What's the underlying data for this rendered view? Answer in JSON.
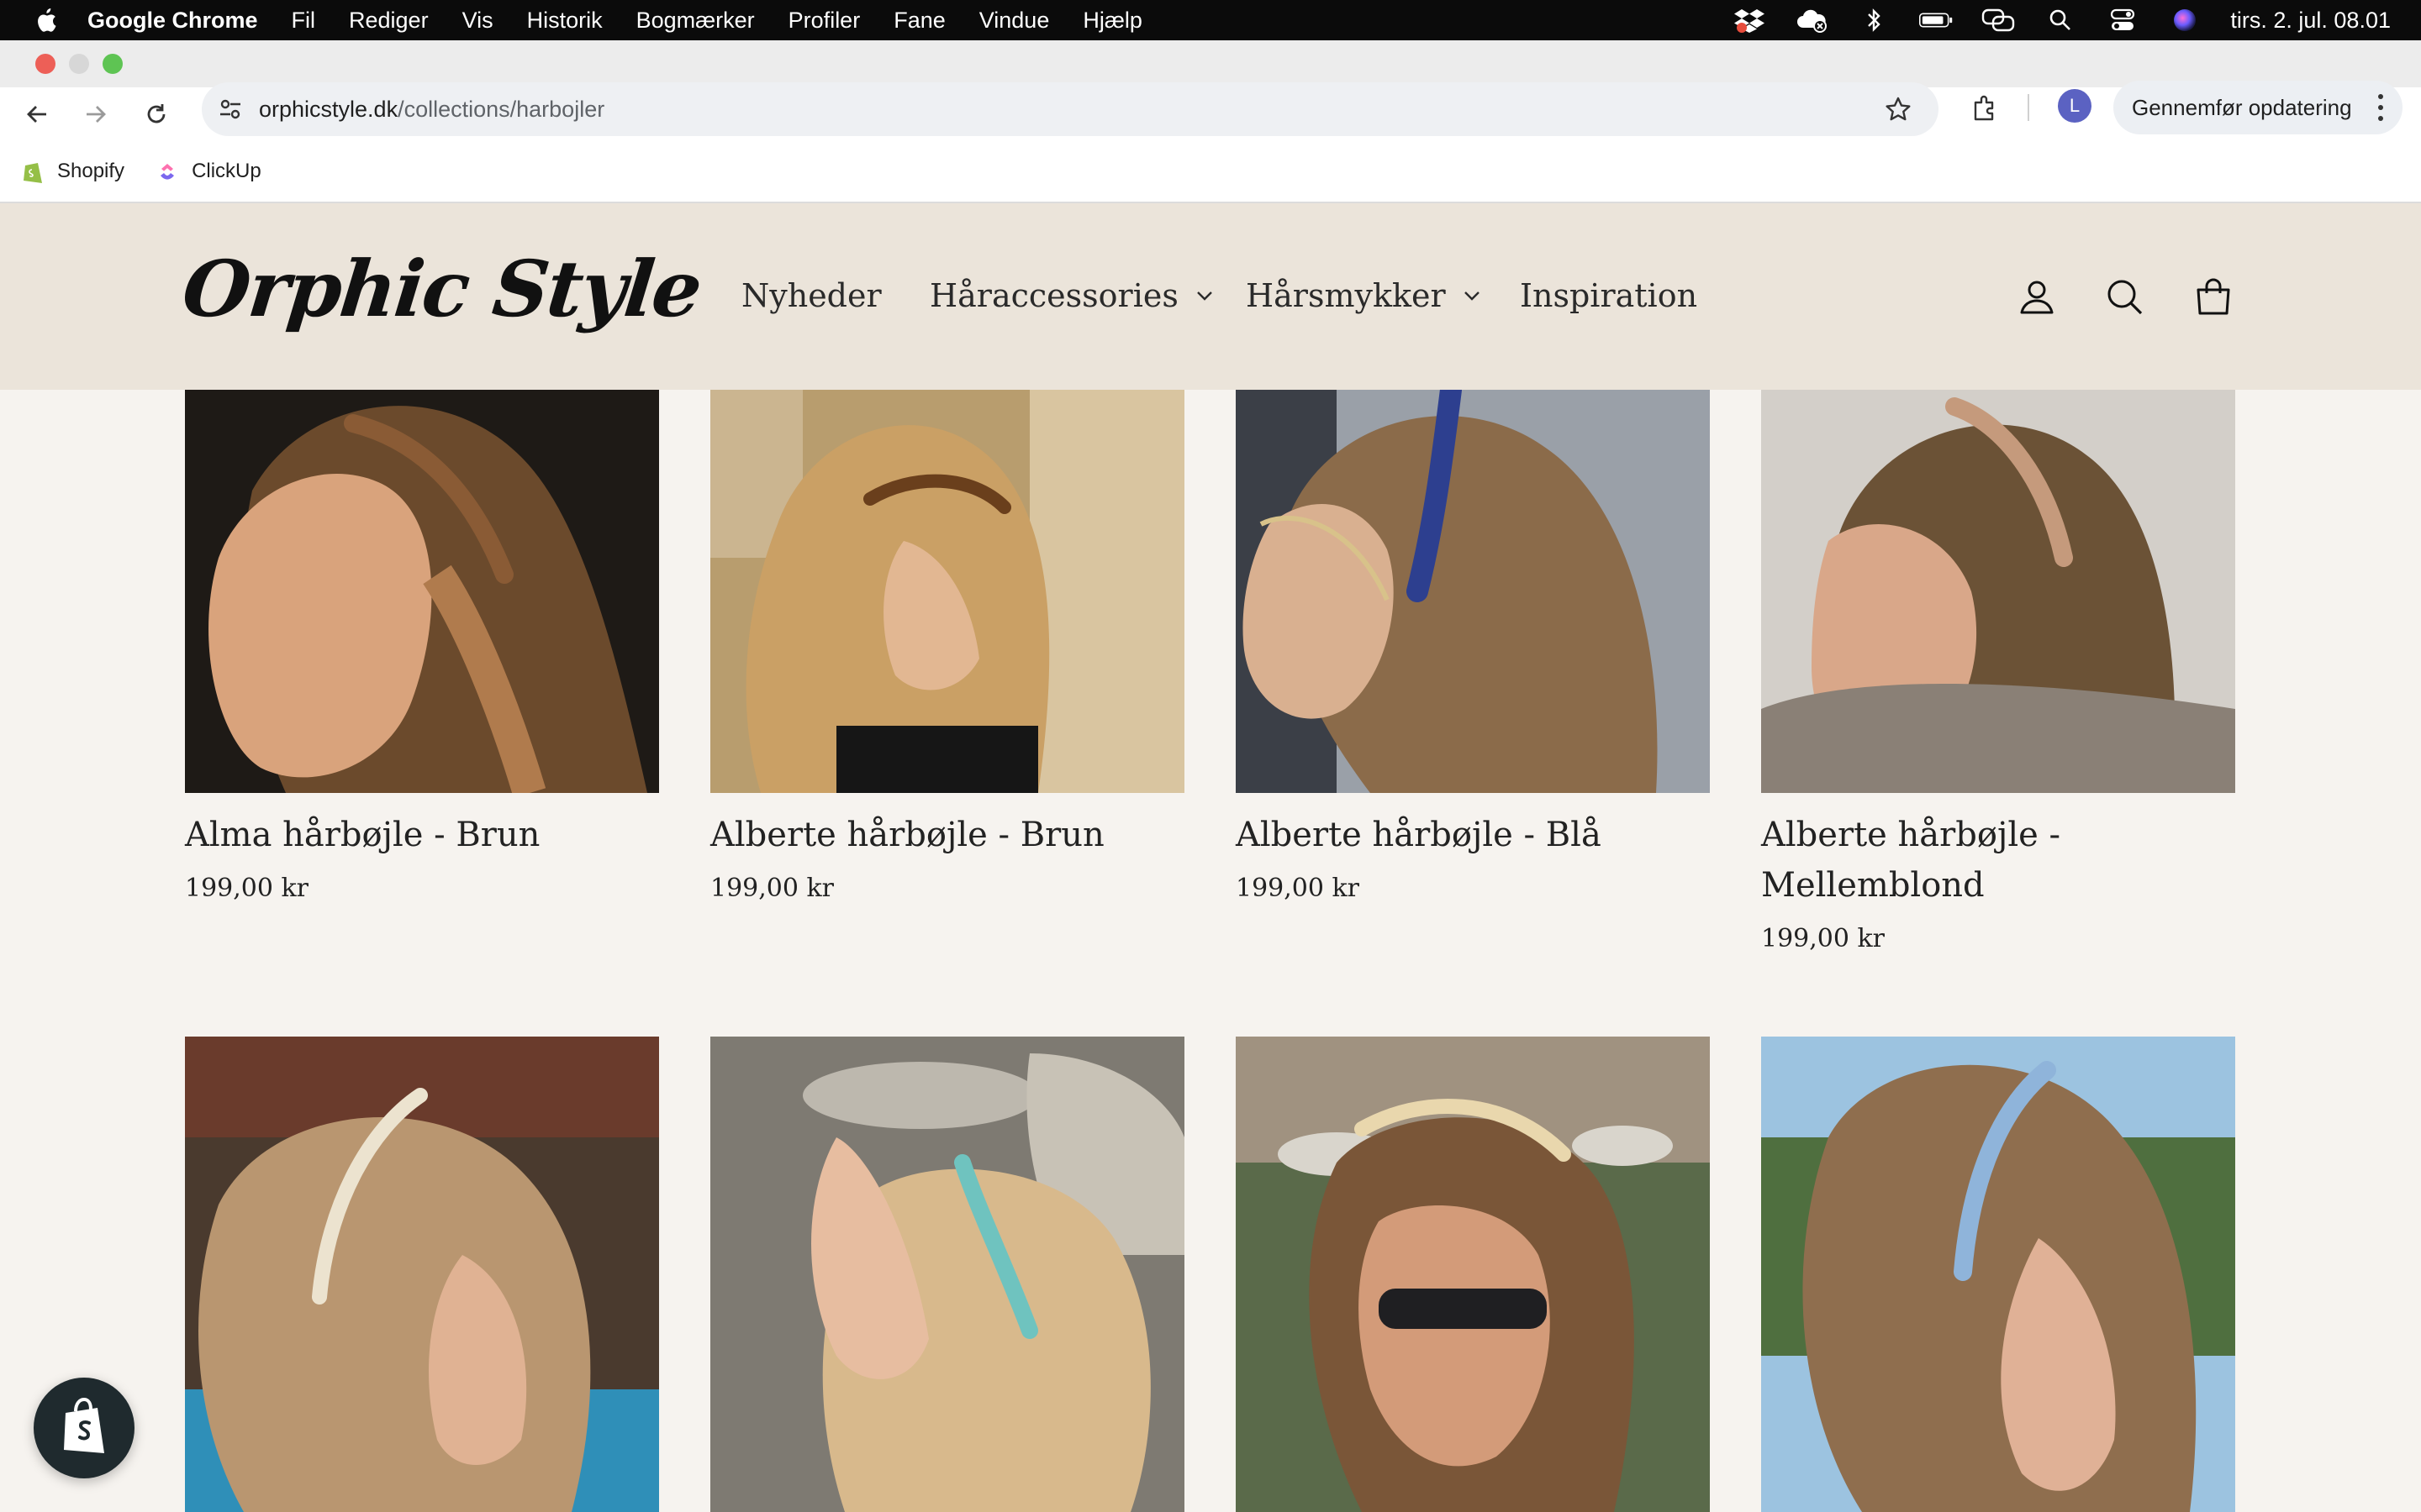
{
  "menubar": {
    "app_name": "Google Chrome",
    "items": [
      "Fil",
      "Rediger",
      "Vis",
      "Historik",
      "Bogmærker",
      "Profiler",
      "Fane",
      "Vindue",
      "Hjælp"
    ],
    "clock": "tirs. 2. jul. 08.01",
    "status_icons": [
      "dropbox-icon",
      "cloud-icon",
      "bluetooth-icon",
      "battery-icon",
      "screen-mirroring-icon",
      "spotlight-icon",
      "control-center-icon",
      "siri-icon"
    ]
  },
  "browser": {
    "url_domain": "orphicstyle.dk",
    "url_path": "/collections/harbojler",
    "profile_initial": "L",
    "update_label": "Gennemfør opdatering",
    "bookmarks": [
      {
        "label": "Shopify",
        "icon": "shopify-icon"
      },
      {
        "label": "ClickUp",
        "icon": "clickup-icon"
      }
    ]
  },
  "site": {
    "logo": "Orphic Style",
    "nav": {
      "nyheder": "Nyheder",
      "haraccessories": "Håraccessories",
      "harsmykker": "Hårsmykker",
      "inspiration": "Inspiration"
    },
    "icons": [
      "account-icon",
      "search-icon",
      "cart-icon"
    ]
  },
  "products": [
    {
      "title": "Alma hårbøjle - Brun",
      "price": "199,00 kr"
    },
    {
      "title": "Alberte hårbøjle - Brun",
      "price": "199,00 kr"
    },
    {
      "title": "Alberte hårbøjle - Blå",
      "price": "199,00 kr"
    },
    {
      "title": "Alberte hårbøjle - Mellemblond",
      "price": "199,00 kr"
    }
  ],
  "colors": {
    "header_bg": "#ebe4da",
    "page_bg": "#f6f3ef",
    "menubar_bg": "#0b0b0b"
  }
}
